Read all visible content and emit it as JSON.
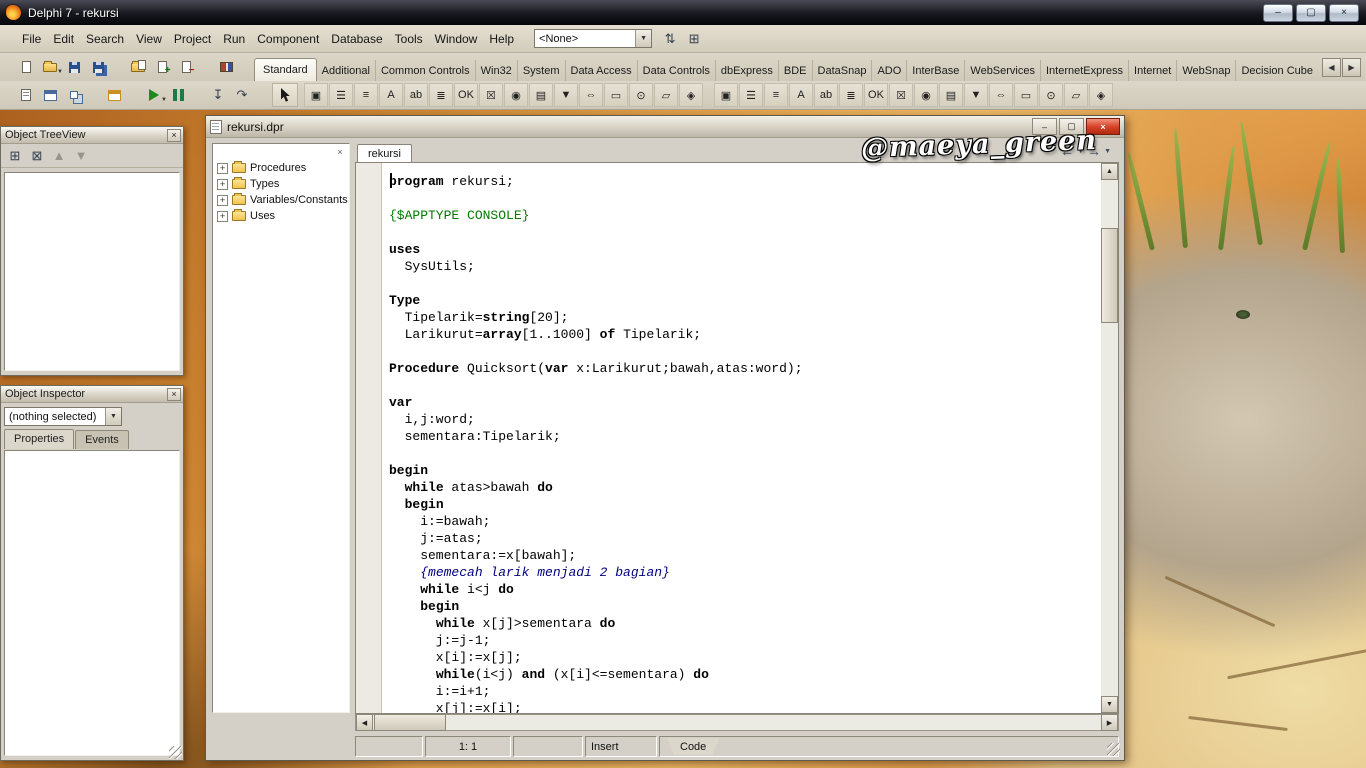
{
  "app": {
    "title": "Delphi 7 - rekursi"
  },
  "glyphs": {
    "minimize": "–",
    "maximize": "▢",
    "close": "×",
    "up": "▲",
    "down": "▼",
    "left": "◀",
    "right": "▶",
    "back": "←",
    "forward": "→",
    "dropdown": "▼",
    "small_close": "×"
  },
  "menu": {
    "items": [
      "File",
      "Edit",
      "Search",
      "View",
      "Project",
      "Run",
      "Component",
      "Database",
      "Tools",
      "Window",
      "Help"
    ],
    "desktop_combo": {
      "value": "<None>"
    }
  },
  "toolbars": {
    "menu_extra": [
      {
        "name": "desktop-save-icon",
        "glyph": "⇅"
      },
      {
        "name": "desktop-settings-icon",
        "glyph": "⊞"
      }
    ],
    "file": [
      {
        "name": "new-file-icon",
        "cls": "i-page"
      },
      {
        "name": "open-file-icon",
        "cls": "i-folder",
        "caret": true
      },
      {
        "name": "save-file-icon",
        "cls": "i-floppy"
      },
      {
        "name": "save-all-icon",
        "cls": "i-floppy2"
      },
      {
        "name": "open-project-icon",
        "cls": "i-folderp",
        "gap": true
      },
      {
        "name": "add-file-to-project-icon",
        "cls": "i-pageplus"
      },
      {
        "name": "remove-file-from-project-icon",
        "cls": "i-pageminus"
      },
      {
        "name": "help-contents-icon",
        "cls": "i-book",
        "gap": true
      }
    ],
    "debug": [
      {
        "name": "view-unit-icon",
        "cls": "i-unit"
      },
      {
        "name": "view-form-icon",
        "cls": "i-form"
      },
      {
        "name": "toggle-form-unit-icon",
        "cls": "i-toggle"
      },
      {
        "name": "new-form-icon",
        "cls": "i-form2",
        "gap": true
      },
      {
        "name": "run-icon",
        "cls": "i-run",
        "gap": true,
        "caret": true
      },
      {
        "name": "pause-icon",
        "cls": "i-pause"
      },
      {
        "name": "trace-into-icon",
        "glyph": "↧",
        "gap": true
      },
      {
        "name": "step-over-icon",
        "glyph": "↷"
      }
    ],
    "treeview": [
      {
        "name": "treeview-new-item-icon",
        "glyph": "⊞"
      },
      {
        "name": "treeview-delete-icon",
        "glyph": "⊠"
      },
      {
        "name": "move-up-icon",
        "glyph": "▲",
        "disabled": true
      },
      {
        "name": "move-down-icon",
        "glyph": "▼",
        "disabled": true
      }
    ]
  },
  "palette": {
    "active_tab": "Standard",
    "tabs": [
      "Standard",
      "Additional",
      "Common Controls",
      "Win32",
      "System",
      "Data Access",
      "Data Controls",
      "dbExpress",
      "BDE",
      "DataSnap",
      "ADO",
      "InterBase",
      "WebServices",
      "InternetExpress",
      "Internet",
      "WebSnap",
      "Decision Cube"
    ],
    "icons": [
      {
        "name": "frames-icon",
        "glyph": "▣"
      },
      {
        "name": "mainmenu-icon",
        "glyph": "☰"
      },
      {
        "name": "popupmenu-icon",
        "glyph": "≡"
      },
      {
        "name": "label-icon",
        "glyph": "A"
      },
      {
        "name": "edit-icon",
        "glyph": "ab"
      },
      {
        "name": "memo-icon",
        "glyph": "≣"
      },
      {
        "name": "button-icon",
        "glyph": "OK"
      },
      {
        "name": "checkbox-icon",
        "glyph": "☒"
      },
      {
        "name": "radiobutton-icon",
        "glyph": "◉"
      },
      {
        "name": "listbox-icon",
        "glyph": "▤"
      },
      {
        "name": "combobox-icon",
        "glyph": "▼"
      },
      {
        "name": "scrollbar-icon",
        "glyph": "⇔"
      },
      {
        "name": "groupbox-icon",
        "glyph": "▭"
      },
      {
        "name": "radiogroup-icon",
        "glyph": "⊙"
      },
      {
        "name": "panel-icon",
        "glyph": "▱"
      },
      {
        "name": "actionlist-icon",
        "glyph": "◈"
      }
    ]
  },
  "object_treeview": {
    "title": "Object TreeView"
  },
  "object_inspector": {
    "title": "Object Inspector",
    "selection": "(nothing selected)",
    "tabs": [
      {
        "label": "Properties",
        "active": true
      },
      {
        "label": "Events",
        "active": false
      }
    ]
  },
  "editor": {
    "window_title": "rekursi.dpr",
    "tab": "rekursi",
    "watermark": "@maeya_green",
    "tree": [
      "Procedures",
      "Types",
      "Variables/Constants",
      "Uses"
    ],
    "status": {
      "caret_pos": "1: 1",
      "mode": "Insert",
      "bottom_tab": "Code"
    },
    "code_lines": [
      [
        [
          "program",
          "k"
        ],
        [
          " rekursi;",
          ""
        ]
      ],
      [],
      [
        [
          "{$APPTYPE CONSOLE}",
          "d"
        ]
      ],
      [],
      [
        [
          "uses",
          "k"
        ]
      ],
      [
        [
          "  SysUtils;",
          ""
        ]
      ],
      [],
      [
        [
          "Type",
          "k"
        ]
      ],
      [
        [
          "  Tipelarik=",
          ""
        ],
        [
          "string",
          "k"
        ],
        [
          "[20];",
          ""
        ]
      ],
      [
        [
          "  Larikurut=",
          ""
        ],
        [
          "array",
          "k"
        ],
        [
          "[1..1000] ",
          ""
        ],
        [
          "of",
          "k"
        ],
        [
          " Tipelarik;",
          ""
        ]
      ],
      [],
      [
        [
          "Procedure",
          "k"
        ],
        [
          " Quicksort(",
          ""
        ],
        [
          "var",
          "k"
        ],
        [
          " x:Larikurut;bawah,atas:word);",
          ""
        ]
      ],
      [],
      [
        [
          "var",
          "k"
        ]
      ],
      [
        [
          "  i,j:word;",
          ""
        ]
      ],
      [
        [
          "  sementara:Tipelarik;",
          ""
        ]
      ],
      [],
      [
        [
          "begin",
          "k"
        ]
      ],
      [
        [
          "  ",
          ""
        ],
        [
          "while",
          "k"
        ],
        [
          " atas>bawah ",
          ""
        ],
        [
          "do",
          "k"
        ]
      ],
      [
        [
          "  ",
          ""
        ],
        [
          "begin",
          "k"
        ]
      ],
      [
        [
          "    i:=bawah;",
          ""
        ]
      ],
      [
        [
          "    j:=atas;",
          ""
        ]
      ],
      [
        [
          "    sementara:=x[bawah];",
          ""
        ]
      ],
      [
        [
          "    ",
          ""
        ],
        [
          "{memecah larik menjadi 2 bagian}",
          "c"
        ]
      ],
      [
        [
          "    ",
          ""
        ],
        [
          "while",
          "k"
        ],
        [
          " i<j ",
          ""
        ],
        [
          "do",
          "k"
        ]
      ],
      [
        [
          "    ",
          ""
        ],
        [
          "begin",
          "k"
        ]
      ],
      [
        [
          "      ",
          ""
        ],
        [
          "while",
          "k"
        ],
        [
          " x[j]>sementara ",
          ""
        ],
        [
          "do",
          "k"
        ]
      ],
      [
        [
          "      j:=j-1;",
          ""
        ]
      ],
      [
        [
          "      x[i]:=x[j];",
          ""
        ]
      ],
      [
        [
          "      ",
          ""
        ],
        [
          "while",
          "k"
        ],
        [
          "(i<j) ",
          ""
        ],
        [
          "and",
          "k"
        ],
        [
          " (x[i]<=sementara) ",
          ""
        ],
        [
          "do",
          "k"
        ]
      ],
      [
        [
          "      i:=i+1;",
          ""
        ]
      ],
      [
        [
          "      x[j]:=x[i];",
          ""
        ]
      ]
    ]
  }
}
